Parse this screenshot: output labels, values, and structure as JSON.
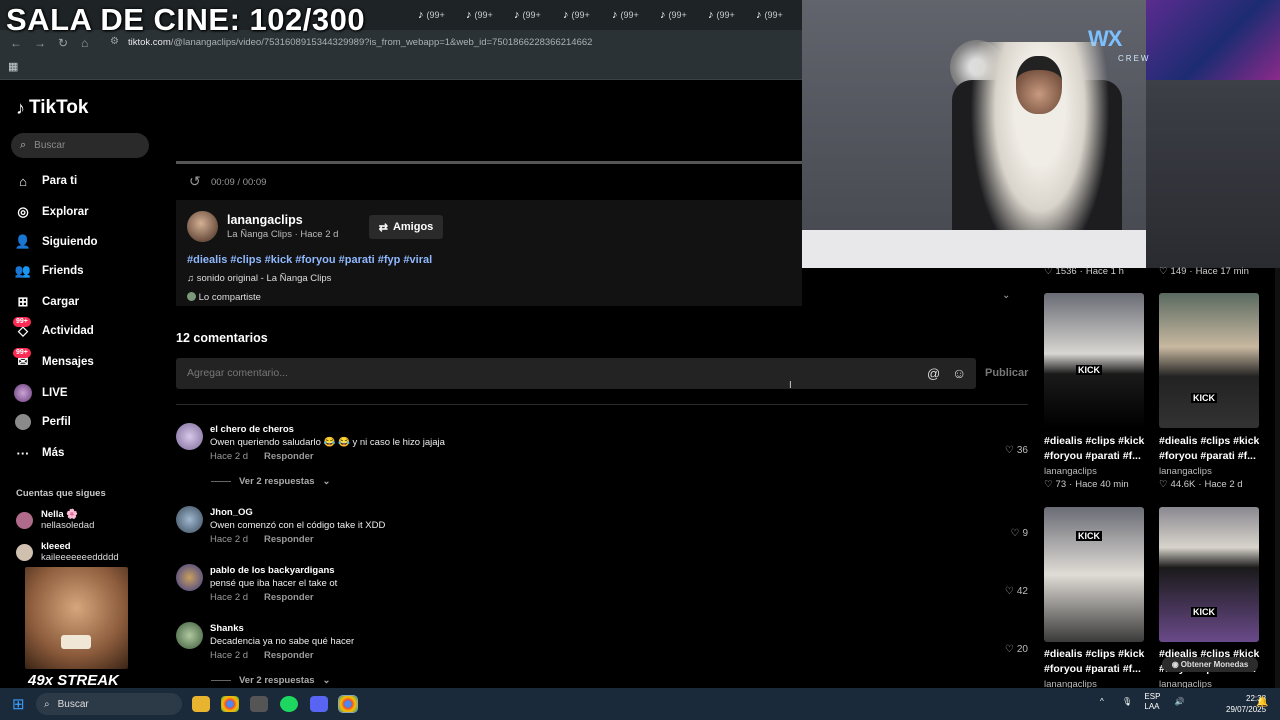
{
  "overlay": {
    "title": "SALA DE CINE: 102/300",
    "streak": "49x STREAK"
  },
  "browser": {
    "tab_badge": "(99+",
    "url_main": "tiktok.com",
    "url_rest": "/@lanangaclips/video/7531608915344329989?is_from_webapp=1&web_id=7501866228366214662"
  },
  "sidebar": {
    "logo": "TikTok",
    "search_placeholder": "Buscar",
    "nav": [
      {
        "label": "Para ti",
        "icon": "home-icon"
      },
      {
        "label": "Explorar",
        "icon": "compass-icon"
      },
      {
        "label": "Siguiendo",
        "icon": "following-icon"
      },
      {
        "label": "Friends",
        "icon": "friends-icon"
      },
      {
        "label": "Cargar",
        "icon": "upload-icon"
      },
      {
        "label": "Actividad",
        "icon": "activity-icon",
        "badge": "99+"
      },
      {
        "label": "Mensajes",
        "icon": "messages-icon",
        "badge": "99+"
      },
      {
        "label": "LIVE",
        "icon": "live-icon"
      },
      {
        "label": "Perfil",
        "icon": "profile-icon"
      },
      {
        "label": "Más",
        "icon": "more-icon"
      }
    ],
    "following_heading": "Cuentas que sigues",
    "following": [
      {
        "name": "Nella 🌸",
        "handle": "nellasoledad"
      },
      {
        "name": "kleeed",
        "handle": "kaileeeeeeeddddd"
      }
    ]
  },
  "video": {
    "time": "00:09 / 00:09",
    "author_name": "lanangaclips",
    "author_sub": "La Ñanga Clips · Hace 2 d",
    "friends_button": "Amigos",
    "hashtags": "#diealis #clips #kick #foryou #parati #fyp #viral",
    "sound": "sonido original - La Ñanga Clips",
    "shared": "Lo compartiste"
  },
  "comments": {
    "count": "12 comentarios",
    "placeholder": "Agregar comentario...",
    "publish": "Publicar",
    "reply_label": "Responder",
    "items": [
      {
        "user": "el chero de cheros",
        "text": "Owen queriendo saludarlo 😂 😂 y ni caso le hizo jajaja",
        "date": "Hace 2 d",
        "likes": "36",
        "replies": "Ver 2 respuestas"
      },
      {
        "user": "Jhon_OG",
        "text": "Owen comenzó con el código take it XDD",
        "date": "Hace 2 d",
        "likes": "9"
      },
      {
        "user": "pablo de los backyardigans",
        "text": "pensé que iba hacer el take ot",
        "date": "Hace 2 d",
        "likes": "42"
      },
      {
        "user": "Shanks",
        "text": "Decadencia ya no sabe qué hacer",
        "date": "Hace 2 d",
        "likes": "20",
        "replies": "Ver 2 respuestas"
      }
    ]
  },
  "webcam": {
    "logo": "WX",
    "crew": "CREW"
  },
  "related": {
    "top_stats": [
      {
        "likes": "1536",
        "age": "Hace 1 h"
      },
      {
        "likes": "149",
        "age": "Hace 17 min"
      }
    ],
    "videos": [
      {
        "caption1": "#diealis #clips #kick",
        "caption2": "#foryou #parati #f...",
        "user": "lanangaclips",
        "likes": "73",
        "age": "Hace 40 min",
        "kick": "KICK"
      },
      {
        "caption1": "#diealis #clips #kick",
        "caption2": "#foryou #parati #f...",
        "user": "lanangaclips",
        "likes": "44.6K",
        "age": "Hace 2 d",
        "kick": "KICK"
      },
      {
        "caption1": "#diealis #clips #kick",
        "caption2": "#foryou #parati #f...",
        "user": "lanangaclips",
        "kick": "KICK"
      },
      {
        "caption1": "#diealis #clips #kick",
        "caption2": "#foryou #parati #f...",
        "user": "lanangaclips",
        "kick": "KICK"
      }
    ],
    "coins": "Obtener Monedas"
  },
  "taskbar": {
    "search": "Buscar",
    "lang1": "ESP",
    "lang2": "LAA",
    "time": "22:38",
    "date": "29/07/2025"
  }
}
